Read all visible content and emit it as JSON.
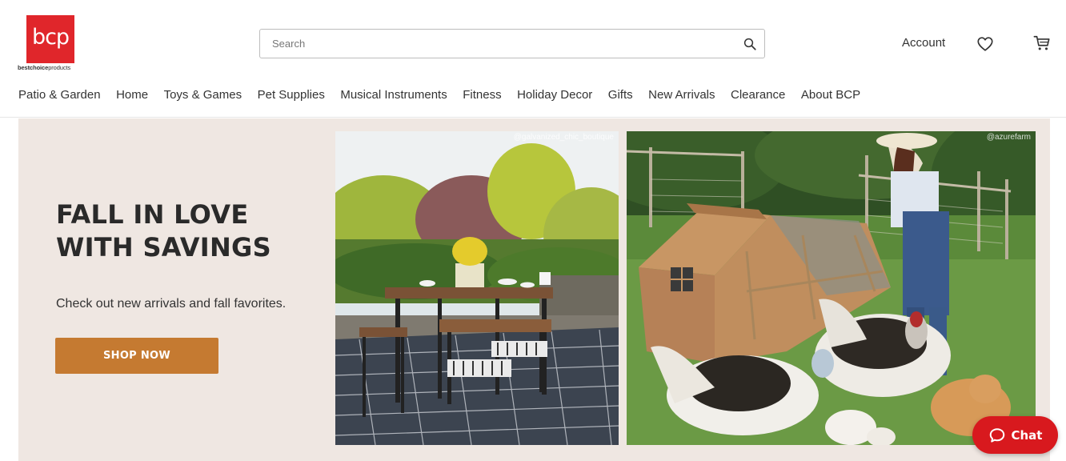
{
  "logo": {
    "mark": "bcp",
    "sub_bold": "bestchoice",
    "sub_rest": "products"
  },
  "search": {
    "placeholder": "Search",
    "icon": "search-icon"
  },
  "header_actions": {
    "account_label": "Account",
    "wishlist_icon": "heart-icon",
    "cart_icon": "cart-icon"
  },
  "nav": {
    "items": [
      "Patio & Garden",
      "Home",
      "Toys & Games",
      "Pet Supplies",
      "Musical Instruments",
      "Fitness",
      "Holiday Decor",
      "Gifts",
      "New Arrivals",
      "Clearance",
      "About BCP"
    ]
  },
  "hero": {
    "title_line1": "FALL IN LOVE",
    "title_line2": "WITH SAVINGS",
    "subtitle": "Check out new arrivals and fall favorites.",
    "cta_label": "SHOP NOW",
    "photo1_credit": "@galvanized_chic_boutique",
    "photo2_credit": "@azurefarm"
  },
  "chat": {
    "label": "Chat",
    "icon": "chat-bubble-icon"
  },
  "colors": {
    "brand_red": "#e0262b",
    "hero_bg": "#efe7e2",
    "cta": "#c57a31",
    "chat": "#d8191e"
  }
}
